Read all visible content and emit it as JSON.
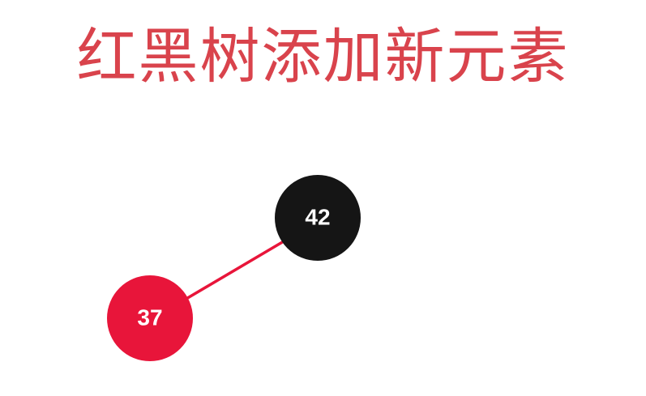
{
  "title": "红黑树添加新元素",
  "colors": {
    "title": "#d9434c",
    "black_node": "#151515",
    "red_node": "#e8153a",
    "edge": "#e8153a",
    "label": "#ffffff"
  },
  "tree": {
    "nodes": [
      {
        "id": "n42",
        "value": "42",
        "color": "black"
      },
      {
        "id": "n37",
        "value": "37",
        "color": "red"
      }
    ],
    "edges": [
      {
        "from": "n42",
        "to": "n37",
        "side": "left"
      }
    ]
  }
}
